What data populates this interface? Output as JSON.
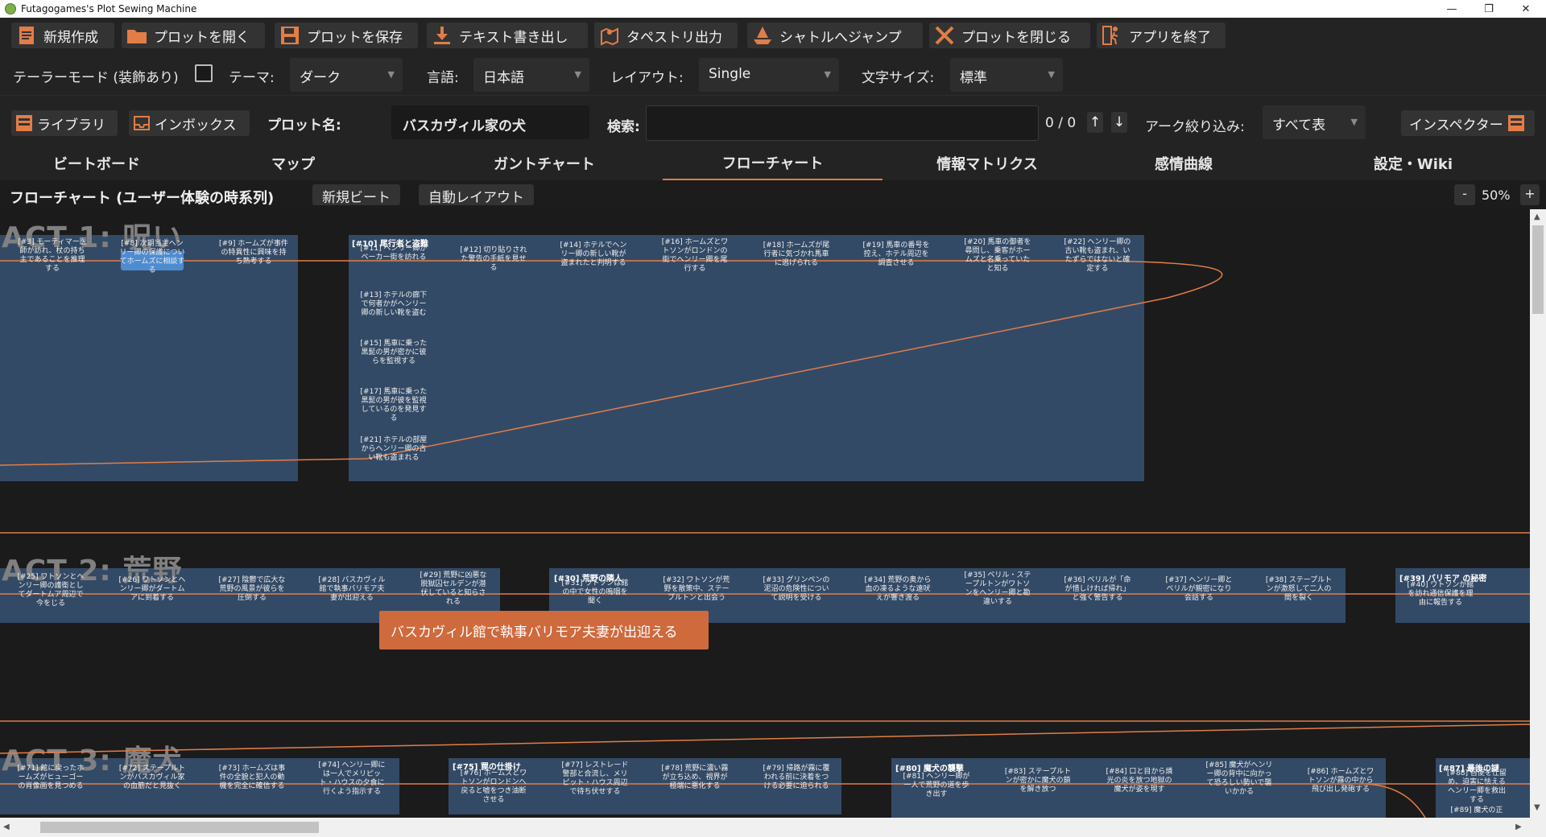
{
  "window": {
    "title": "Futagogames's Plot Sewing Machine",
    "controls": [
      "—",
      "❐",
      "✕"
    ]
  },
  "toolbar": {
    "new": "新規作成",
    "open": "プロットを開く",
    "save": "プロットを保存",
    "export_text": "テキスト書き出し",
    "tapestry": "タペストリ出力",
    "shuttle": "シャトルへジャンプ",
    "close_plot": "プロットを閉じる",
    "quit": "アプリを終了"
  },
  "settings": {
    "tailor_label": "テーラーモード (装飾あり)",
    "theme_label": "テーマ:",
    "theme_value": "ダーク",
    "lang_label": "言語:",
    "lang_value": "日本語",
    "layout_label": "レイアウト:",
    "layout_value": "Single",
    "fontsize_label": "文字サイズ:",
    "fontsize_value": "標準"
  },
  "row3": {
    "library": "ライブラリ",
    "inbox": "インボックス",
    "plot_name_label": "プロット名:",
    "plot_name": "バスカヴィル家の犬",
    "search_label": "検索:",
    "search_value": "",
    "search_count": "0 / 0",
    "arc_label": "アーク絞り込み:",
    "arc_value": "すべて表",
    "inspector": "インスペクター"
  },
  "tabs": [
    "ビートボード",
    "マップ",
    "ガントチャート",
    "フローチャート",
    "情報マトリクス",
    "感情曲線",
    "設定・Wiki"
  ],
  "flow": {
    "title": "フローチャート (ユーザー体験の時系列)",
    "new_beat": "新規ビート",
    "auto_layout": "自動レイアウト",
    "zoom_minus": "-",
    "zoom": "50%",
    "zoom_plus": "+"
  },
  "acts": [
    "ACT 1: 呪い",
    "ACT 2: 荒野",
    "ACT 3: 魔犬"
  ],
  "groups": {
    "g10": "[#10] 尾行者と盗難",
    "g30": "[#30] 荒野の隣人",
    "g39": "[#39] バリモア の秘密",
    "g75": "[#75] 罠の仕掛け",
    "g80": "[#80] 魔犬の襲撃",
    "g87": "[#87] 最後の謎"
  },
  "beats": {
    "b3": "[#3] モーティマー医師が訪れ、杖の持ち主であることを推理する",
    "b8": "[#8] 次期当主ヘンリー卿の保護についてホームズに相談する",
    "b9": "[#9] ホームズが事件の特異性に興味を持ち熟考する",
    "b11": "[#11] ヘンリー卿がベーカー街を訪れる",
    "b12": "[#12] 切り貼りされた警告の手紙を見せる",
    "b14": "[#14] ホテルでヘンリー卿の新しい靴が盗まれたと判明する",
    "b16": "[#16] ホームズとワトソンがロンドンの街でヘンリー卿を尾行する",
    "b18": "[#18] ホームズが尾行者に気づかれ馬車に逃げられる",
    "b19": "[#19] 馬車の番号を控え、ホテル周辺を調査させる",
    "b20": "[#20] 馬車の御者を尋問し、乗客がホームズと名乗っていたと知る",
    "b22": "[#22] ヘンリー卿の古い靴も盗まれ、いたずらではないと確定する",
    "b13": "[#13] ホテルの廊下で何者かがヘンリー卿の新しい靴を盗む",
    "b15": "[#15] 馬車に乗った黒髭の男が密かに彼らを監視する",
    "b17": "[#17] 馬車に乗った黒髭の男が彼を監視しているのを発見する",
    "b21": "[#21] ホテルの部屋からヘンリー卿の古い靴も盗まれる",
    "b25": "[#25] ワトソンとヘンリー卿の護衛としてダートムア周辺で今をじる",
    "b26": "[#26] ワトソンとヘンリー卿がダートムアに到着する",
    "b27": "[#27] 陰鬱で広大な荒野の風景が彼らを圧倒する",
    "b28": "[#28] バスカヴィル館で執事バリモア夫妻が出迎える",
    "b29": "[#29] 荒野に凶悪な脱獄囚セルデンが潜伏していると知らされる",
    "b31": "[#31] ワトソンは館の中で女性の嗚咽を聞く",
    "b32": "[#32] ワトソンが荒野を散策中、ステープルトンと出会う",
    "b33": "[#33] グリンペンの泥沼の危険性について説明を受ける",
    "b34": "[#34] 荒野の奥から血の凍るような遠吠えが響き渡る",
    "b35": "[#35] ベリル・ステープルトンがワトソンをヘンリー卿と勘違いする",
    "b36": "[#36] ベリルが「命が惜しければ帰れ」と強く警告する",
    "b37": "[#37] ヘンリー卿とベリルが親密になり会話する",
    "b38": "[#38] ステープルトンが激怒して二人の間を裂く",
    "b40": "[#40] ワトソンが館を訪れ通信保護を理由に報告する",
    "b71": "[#71] 館に戻ったホームズがヒューゴーの肖像画を見つめる",
    "b72": "[#72] ステープルトンがバスカヴィル家の血筋だと見抜く",
    "b73": "[#73] ホームズは事件の全貌と犯人の動機を完全に確信する",
    "b74": "[#74] ヘンリー卿には一人でメリピット・ハウスの夕食に行くよう指示する",
    "b76": "[#76] ホームズとワトソンがロンドンへ戻ると嘘をつき油断させる",
    "b77": "[#77] レストレード警部と合流し、メリピット・ハウス周辺で待ち伏せする",
    "b78": "[#78] 荒野に濃い霧が立ち込め、視界が極端に悪化する",
    "b79": "[#79] 帰路が霧に覆われる前に決着をつける必要に迫られる",
    "b81": "[#81] ヘンリー卿が一人で荒野の道を歩き出す",
    "b83": "[#83] ステープルトンが密かに魔犬の鎖を解き放つ",
    "b84": "[#84] 口と目から燐光の炎を放つ地獄の魔犬が姿を現す",
    "b85": "[#85] 魔犬がヘンリー卿の背中に向かって恐ろしい勢いで襲いかかる",
    "b86": "[#86] ホームズとワトソンが霧の中から飛び出し発砲する",
    "b88": "[#88] 召使を仕留め、迫害に怯えるヘンリー卿を救出する",
    "b89": "[#89] 魔犬の正"
  },
  "tooltip": "バスカヴィル館で執事バリモア夫妻が出迎える",
  "colors": {
    "accent": "#e27d47",
    "group": "#334a66",
    "red": "#d64a4a",
    "yellow": "#c9c93a",
    "green": "#55c455",
    "blue": "#4e8cd0"
  }
}
